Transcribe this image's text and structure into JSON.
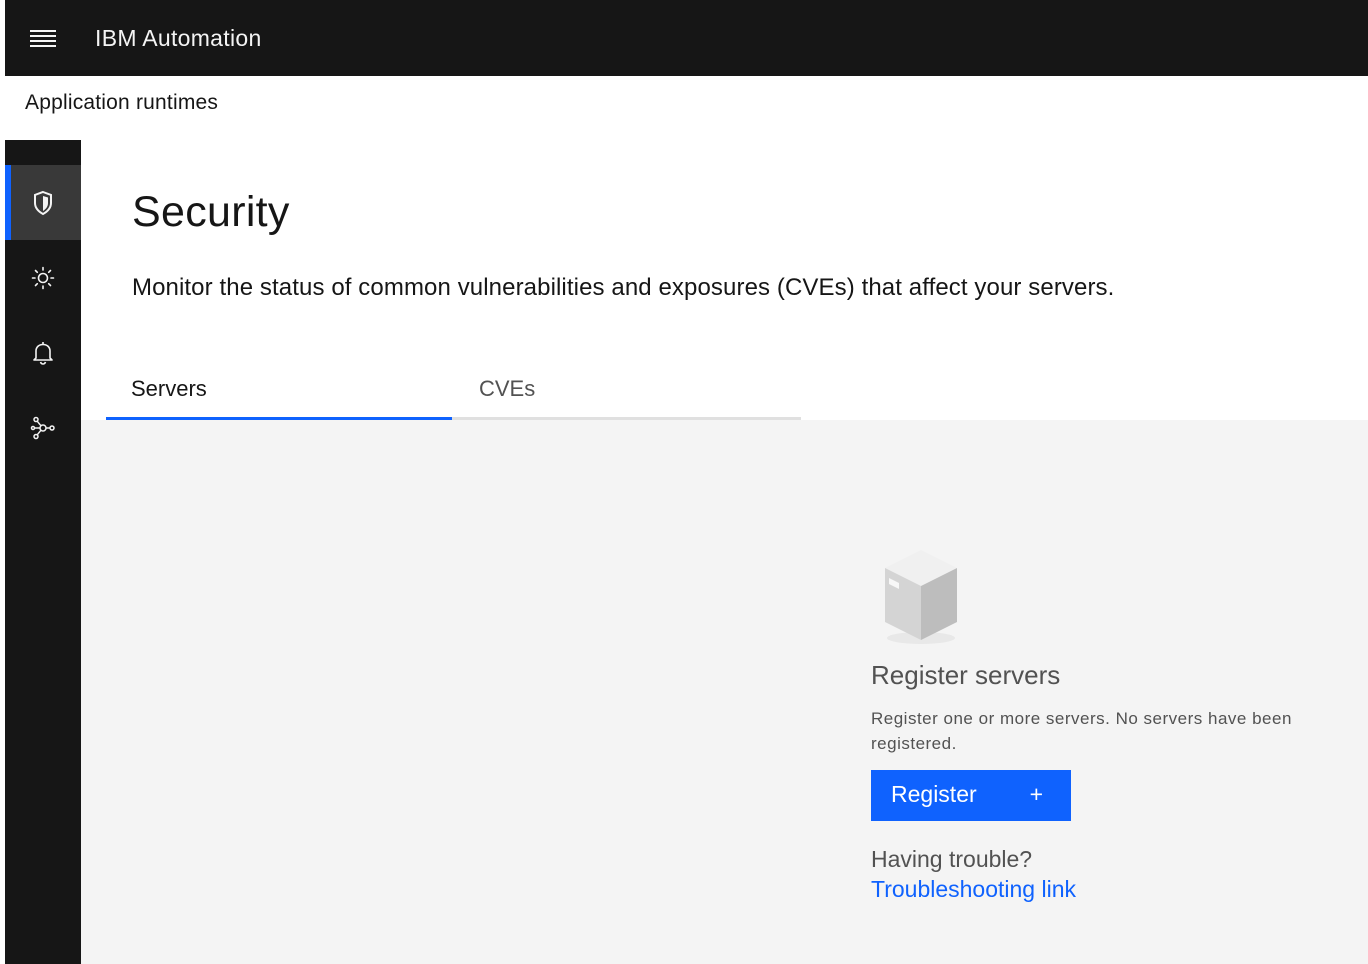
{
  "header": {
    "app_title": "IBM Automation",
    "menu_icon": "hamburger-menu-icon"
  },
  "subheader": {
    "title": "Application runtimes"
  },
  "sidebar": {
    "items": [
      {
        "icon": "shield-icon",
        "active": true
      },
      {
        "icon": "sun-icon",
        "active": false
      },
      {
        "icon": "bell-icon",
        "active": false
      },
      {
        "icon": "network-icon",
        "active": false
      }
    ]
  },
  "main": {
    "title": "Security",
    "description": "Monitor the status of common vulnerabilities and exposures (CVEs) that affect your servers.",
    "tabs": [
      {
        "label": "Servers",
        "selected": true
      },
      {
        "label": "CVEs",
        "selected": false
      }
    ],
    "empty_state": {
      "icon": "box-icon",
      "title": "Register servers",
      "body": "Register one or more servers. No servers have been registered.",
      "button_label": "Register",
      "button_icon": "+",
      "trouble_text": "Having trouble?",
      "link_text": "Troubleshooting link"
    }
  },
  "colors": {
    "header_bg": "#161616",
    "accent": "#0f62fe",
    "content_bg": "#f4f4f4",
    "rail_active_bg": "#393939"
  }
}
